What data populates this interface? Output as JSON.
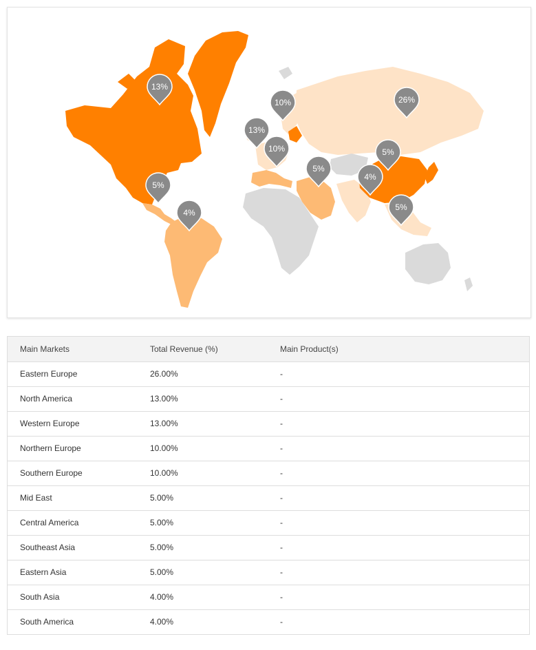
{
  "colors": {
    "highlight": "#ff8000",
    "light_orange": "#fdba74",
    "pale": "#fee3c7",
    "neutral": "#dadada",
    "pin": "#8a8a8a"
  },
  "map": {
    "pins": [
      {
        "id": "north-america",
        "label": "13%"
      },
      {
        "id": "central-america",
        "label": "5%"
      },
      {
        "id": "south-america",
        "label": "4%"
      },
      {
        "id": "western-europe",
        "label": "13%"
      },
      {
        "id": "northern-europe",
        "label": "10%"
      },
      {
        "id": "southern-europe",
        "label": "10%"
      },
      {
        "id": "eastern-europe",
        "label": "26%"
      },
      {
        "id": "mid-east",
        "label": "5%"
      },
      {
        "id": "eastern-asia",
        "label": "5%"
      },
      {
        "id": "south-asia",
        "label": "4%"
      },
      {
        "id": "southeast-asia",
        "label": "5%"
      }
    ]
  },
  "table": {
    "headers": [
      "Main Markets",
      "Total Revenue (%)",
      "Main Product(s)"
    ],
    "rows": [
      [
        "Eastern Europe",
        "26.00%",
        "-"
      ],
      [
        "North America",
        "13.00%",
        "-"
      ],
      [
        "Western Europe",
        "13.00%",
        "-"
      ],
      [
        "Northern Europe",
        "10.00%",
        "-"
      ],
      [
        "Southern Europe",
        "10.00%",
        "-"
      ],
      [
        "Mid East",
        "5.00%",
        "-"
      ],
      [
        "Central America",
        "5.00%",
        "-"
      ],
      [
        "Southeast Asia",
        "5.00%",
        "-"
      ],
      [
        "Eastern Asia",
        "5.00%",
        "-"
      ],
      [
        "South Asia",
        "4.00%",
        "-"
      ],
      [
        "South America",
        "4.00%",
        "-"
      ]
    ]
  }
}
